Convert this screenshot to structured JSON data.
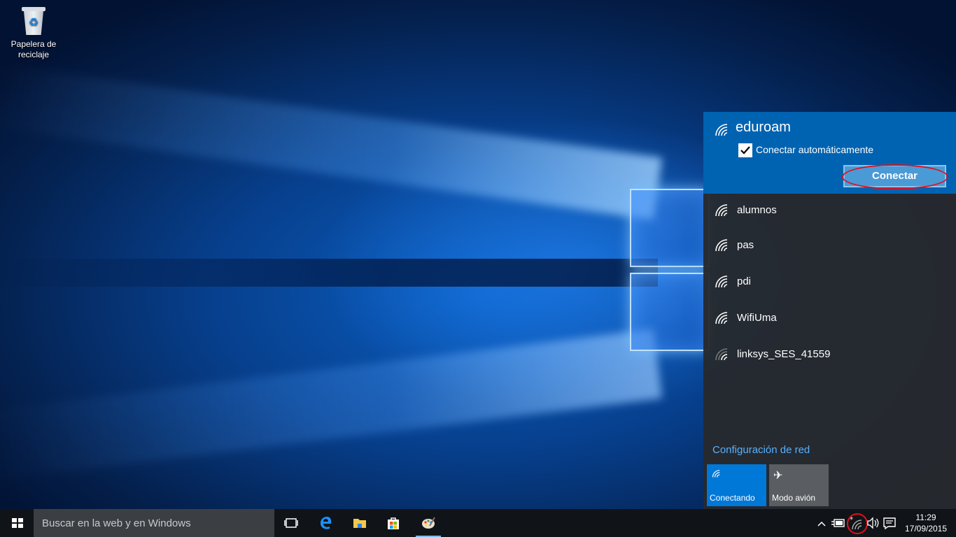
{
  "desktop": {
    "recycle_bin_label": "Papelera de reciclaje"
  },
  "network_flyout": {
    "selected_network": {
      "name": "eduroam",
      "auto_connect_label": "Conectar automáticamente",
      "auto_connect_checked": true,
      "connect_button": "Conectar"
    },
    "networks": [
      {
        "name": "alumnos"
      },
      {
        "name": "pas"
      },
      {
        "name": "pdi"
      },
      {
        "name": "WifiUma"
      },
      {
        "name": "linksys_SES_41559"
      }
    ],
    "settings_link": "Configuración de red",
    "quick_actions": {
      "wifi_label": "Conectando",
      "airplane_label": "Modo avión"
    }
  },
  "taskbar": {
    "search_placeholder": "Buscar en la web y en Windows",
    "clock_time": "11:29",
    "clock_date": "17/09/2015"
  },
  "colors": {
    "accent": "#0078d7",
    "selected_bg": "#0063b1",
    "link": "#57b0ff",
    "highlight_ring": "#e0101c"
  }
}
